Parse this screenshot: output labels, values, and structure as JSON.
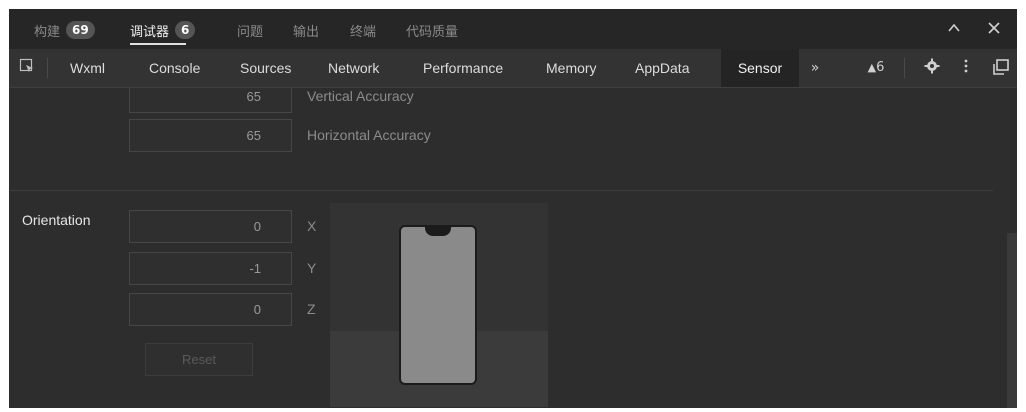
{
  "panel_tabs": [
    {
      "label": "构建",
      "badge": "69"
    },
    {
      "label": "调试器",
      "badge": "6"
    },
    {
      "label": "问题"
    },
    {
      "label": "输出"
    },
    {
      "label": "终端"
    },
    {
      "label": "代码质量"
    }
  ],
  "panel_active_tab": "调试器",
  "panel_controls": {
    "collapse_icon": "^",
    "close_icon": "✕"
  },
  "devtools_tabs": [
    "Wxml",
    "Console",
    "Sources",
    "Network",
    "Performance",
    "Memory",
    "AppData",
    "Sensor"
  ],
  "devtools_active_tab": "Sensor",
  "toolbar": {
    "more_icon": "»",
    "warning_count": "6",
    "warning_icon": "▲"
  },
  "location": {
    "vertical_accuracy_value": "65",
    "vertical_accuracy_label": "Vertical Accuracy",
    "horizontal_accuracy_value": "65",
    "horizontal_accuracy_label": "Horizontal Accuracy"
  },
  "orientation": {
    "section_label": "Orientation",
    "x_value": "0",
    "x_label": "X",
    "y_value": "-1",
    "y_label": "Y",
    "z_value": "0",
    "z_label": "Z",
    "reset_label": "Reset"
  },
  "colors": {
    "background": "#2d2d2d",
    "topbar": "#262626",
    "toolbar": "#333333",
    "active_tab": "#242424",
    "text": "#dcdcdc",
    "muted": "#8c8c8c"
  }
}
